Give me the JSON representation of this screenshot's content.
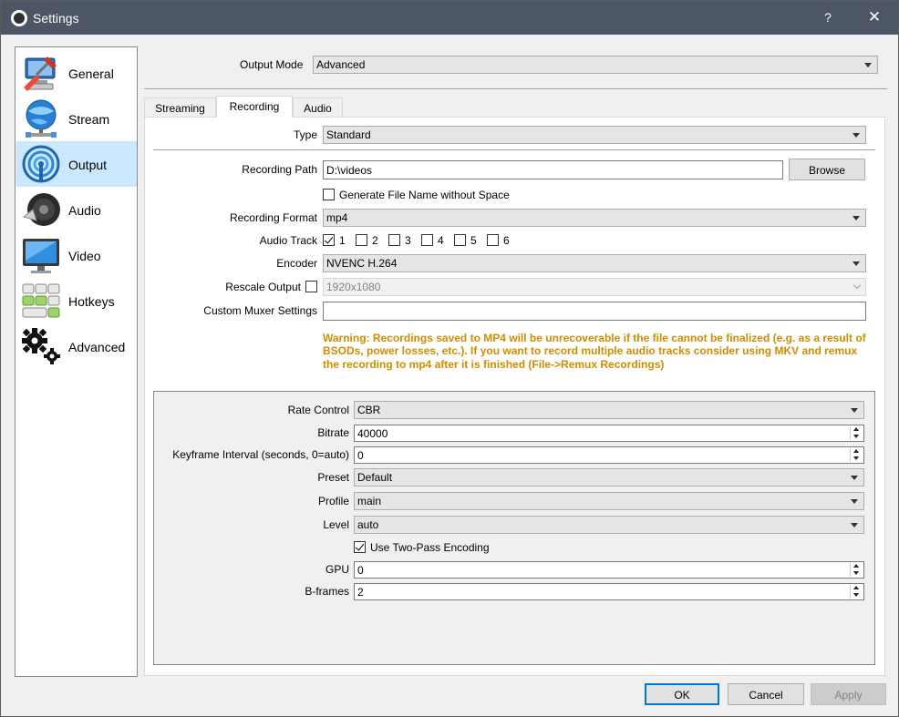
{
  "window": {
    "title": "Settings",
    "help_label": "?",
    "close_label": "✕"
  },
  "sidebar": {
    "items": [
      {
        "label": "General",
        "icon": "general-icon",
        "active": false
      },
      {
        "label": "Stream",
        "icon": "stream-icon",
        "active": false
      },
      {
        "label": "Output",
        "icon": "output-icon",
        "active": true
      },
      {
        "label": "Audio",
        "icon": "audio-icon",
        "active": false
      },
      {
        "label": "Video",
        "icon": "video-icon",
        "active": false
      },
      {
        "label": "Hotkeys",
        "icon": "hotkeys-icon",
        "active": false
      },
      {
        "label": "Advanced",
        "icon": "advanced-icon",
        "active": false
      }
    ]
  },
  "output_mode": {
    "label": "Output Mode",
    "value": "Advanced"
  },
  "tabs": [
    {
      "label": "Streaming",
      "active": false
    },
    {
      "label": "Recording",
      "active": true
    },
    {
      "label": "Audio",
      "active": false
    }
  ],
  "recording": {
    "type": {
      "label": "Type",
      "value": "Standard"
    },
    "path": {
      "label": "Recording Path",
      "value": "D:\\videos",
      "browse_label": "Browse"
    },
    "no_space": {
      "label": "Generate File Name without Space",
      "checked": false
    },
    "format": {
      "label": "Recording Format",
      "value": "mp4"
    },
    "audio_track": {
      "label": "Audio Track",
      "tracks": [
        {
          "label": "1",
          "checked": true
        },
        {
          "label": "2",
          "checked": false
        },
        {
          "label": "3",
          "checked": false
        },
        {
          "label": "4",
          "checked": false
        },
        {
          "label": "5",
          "checked": false
        },
        {
          "label": "6",
          "checked": false
        }
      ]
    },
    "encoder": {
      "label": "Encoder",
      "value": "NVENC H.264"
    },
    "rescale": {
      "label": "Rescale Output",
      "checked": false,
      "value": "1920x1080"
    },
    "muxer": {
      "label": "Custom Muxer Settings",
      "value": ""
    },
    "warning": "Warning: Recordings saved to MP4 will be unrecoverable if the file cannot be finalized (e.g. as a result of BSODs, power losses, etc.). If you want to record multiple audio tracks consider using MKV and remux the recording to mp4 after it is finished (File->Remux Recordings)"
  },
  "encoder_settings": {
    "rate_control": {
      "label": "Rate Control",
      "value": "CBR"
    },
    "bitrate": {
      "label": "Bitrate",
      "value": "40000"
    },
    "keyframe": {
      "label": "Keyframe Interval (seconds, 0=auto)",
      "value": "0"
    },
    "preset": {
      "label": "Preset",
      "value": "Default"
    },
    "profile": {
      "label": "Profile",
      "value": "main"
    },
    "level": {
      "label": "Level",
      "value": "auto"
    },
    "two_pass": {
      "label": "Use Two-Pass Encoding",
      "checked": true
    },
    "gpu": {
      "label": "GPU",
      "value": "0"
    },
    "bframes": {
      "label": "B-frames",
      "value": "2"
    }
  },
  "buttons": {
    "ok": "OK",
    "cancel": "Cancel",
    "apply": "Apply"
  },
  "colors": {
    "titlebar": "#4d5665",
    "selection": "#cce8ff",
    "warning": "#d18c00",
    "accent": "#0078d7"
  }
}
